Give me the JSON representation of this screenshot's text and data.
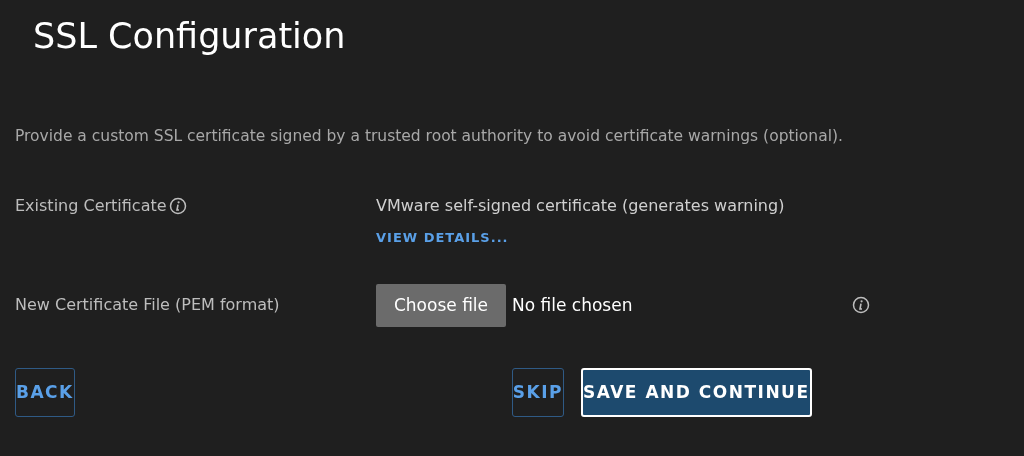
{
  "title": "SSL Configuration",
  "description": "Provide a custom SSL certificate signed by a trusted root authority to avoid certificate warnings (optional).",
  "existing_certificate": {
    "label": "Existing Certificate",
    "value": "VMware self-signed certificate (generates warning)",
    "link": "VIEW DETAILS..."
  },
  "new_certificate": {
    "label": "New Certificate File (PEM format)",
    "button": "Choose file",
    "status": "No file chosen"
  },
  "buttons": [
    {
      "label": "BACK",
      "kind": "outline"
    },
    {
      "label": "SKIP",
      "kind": "outline"
    },
    {
      "label": "SAVE AND CONTINUE",
      "kind": "primary"
    }
  ]
}
